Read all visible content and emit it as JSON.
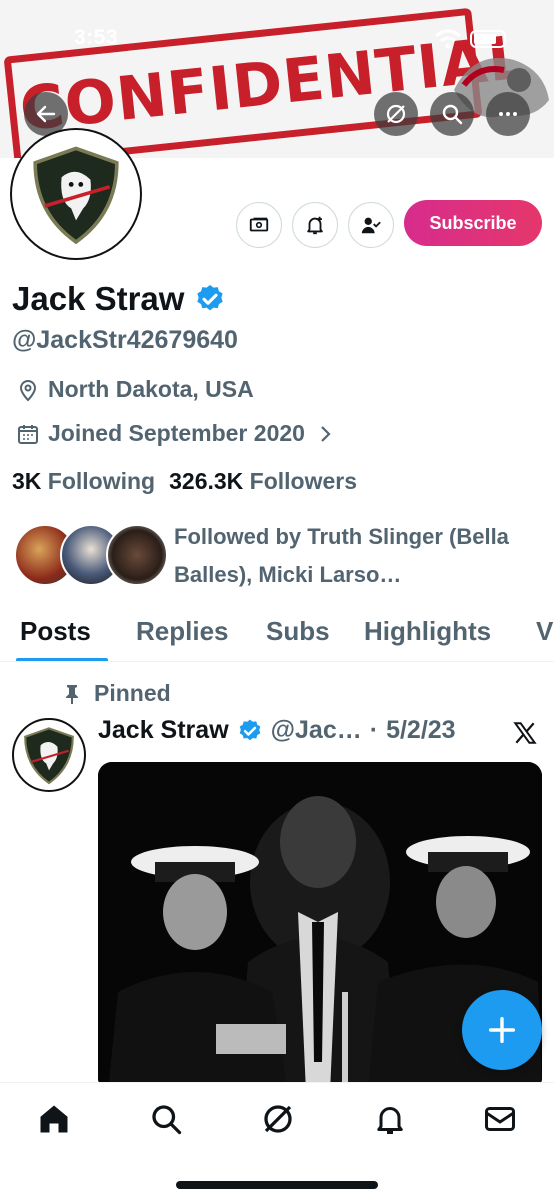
{
  "status_bar": {
    "time": "3:53"
  },
  "banner": {
    "stamp_text": "CONFIDENTIAL"
  },
  "header": {
    "back_icon": "arrow-left-icon",
    "grok_icon": "slash-circle-icon",
    "search_icon": "search-icon",
    "more_icon": "more-horizontal-icon"
  },
  "profile": {
    "name": "Jack Straw",
    "handle": "@JackStr42679640",
    "location": "North Dakota, USA",
    "joined": "Joined September 2020",
    "following_count": "3K",
    "following_label": "Following",
    "followers_count": "326.3K",
    "followers_label": "Followers",
    "followed_by": "Followed by Truth Slinger (Bella Balles), Micki Larso…",
    "subscribe_label": "Subscribe",
    "verified_color": "#1d9bf0"
  },
  "tabs": [
    {
      "label": "Posts",
      "active": true
    },
    {
      "label": "Replies"
    },
    {
      "label": "Subs"
    },
    {
      "label": "Highlights"
    },
    {
      "label": "V"
    }
  ],
  "post": {
    "pinned_label": "Pinned",
    "name": "Jack Straw",
    "handle": "@Jac…",
    "separator": "·",
    "date": "5/2/23"
  },
  "colors": {
    "accent": "#1d9bf0",
    "subscribe_gradient_start": "#d72c8d",
    "stamp": "#c8202b"
  }
}
